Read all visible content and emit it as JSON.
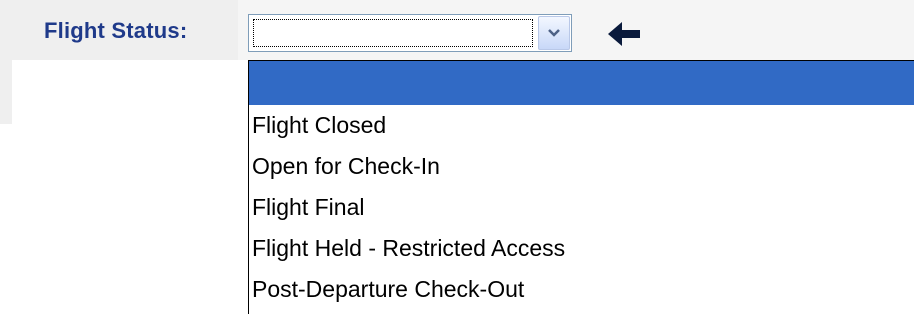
{
  "flight_status": {
    "label": "Flight Status:",
    "selected_value": "",
    "options": [
      "",
      "Flight Closed",
      "Open for Check-In",
      "Flight Final",
      "Flight Held - Restricted Access",
      "Post-Departure Check-Out"
    ],
    "highlighted_index": 0,
    "arrow_icon": "chevron-down-icon",
    "back_icon": "arrow-left-icon"
  },
  "colors": {
    "label": "#1f3a8a",
    "highlight": "#316ac5",
    "row_background": "#efefef"
  }
}
